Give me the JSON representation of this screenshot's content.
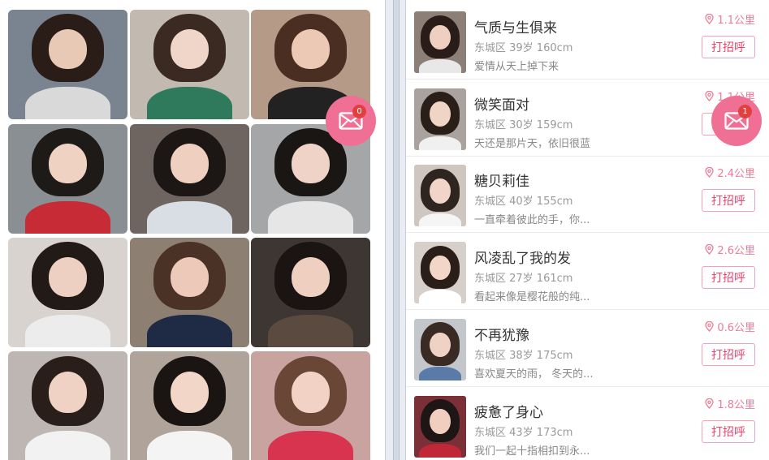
{
  "photo_grid": {
    "photos": [
      {
        "bg": "#7a8390",
        "hair": "#2a1d18",
        "skin": "#e8c9b6",
        "cloth": "#d9d9d9"
      },
      {
        "bg": "#c2b9b0",
        "hair": "#3a2a22",
        "skin": "#f0d6c8",
        "cloth": "#2f7a5c"
      },
      {
        "bg": "#b59a88",
        "hair": "#4a2e22",
        "skin": "#ecc9b4",
        "cloth": "#222222"
      },
      {
        "bg": "#8a8f94",
        "hair": "#1e1a18",
        "skin": "#f0d2c2",
        "cloth": "#c72b35"
      },
      {
        "bg": "#6e6460",
        "hair": "#1c1614",
        "skin": "#efcfc0",
        "cloth": "#d9dde4"
      },
      {
        "bg": "#a4a6a8",
        "hair": "#1a1614",
        "skin": "#eed3c6",
        "cloth": "#e6e6e6"
      },
      {
        "bg": "#d9d3cf",
        "hair": "#221a16",
        "skin": "#eed0c2",
        "cloth": "#ececec"
      },
      {
        "bg": "#8d8073",
        "hair": "#4a3226",
        "skin": "#ecc9b8",
        "cloth": "#1f2a45"
      },
      {
        "bg": "#3e3632",
        "hair": "#1a1412",
        "skin": "#efcfc0",
        "cloth": "#5a4a40"
      },
      {
        "bg": "#bdb6b2",
        "hair": "#2a1e1a",
        "skin": "#efd2c4",
        "cloth": "#f2f2f2"
      },
      {
        "bg": "#b0a49a",
        "hair": "#1a1412",
        "skin": "#f2d6c8",
        "cloth": "#f4f4f4"
      },
      {
        "bg": "#c9a3a0",
        "hair": "#6a4636",
        "skin": "#f3d2c6",
        "cloth": "#d8334f"
      }
    ]
  },
  "left_fab": {
    "badge": "0"
  },
  "right_fab": {
    "badge": "1"
  },
  "profiles": [
    {
      "name": "气质与生俱来",
      "meta": "东城区 39岁 160cm",
      "desc": "爱情从天上掉下来",
      "distance": "1.1公里",
      "button": "打招呼",
      "avatar": {
        "bg": "#8c7f77",
        "hair": "#2a1c18",
        "skin": "#efcfbf",
        "cloth": "#e8e8e8"
      }
    },
    {
      "name": "微笑面对",
      "meta": "东城区 30岁 159cm",
      "desc": "天还是那片天，依旧很蓝",
      "distance": "1.1公里",
      "button": "打招呼",
      "avatar": {
        "bg": "#a9a29e",
        "hair": "#2a1e18",
        "skin": "#f0d4c6",
        "cloth": "#f0f0f0"
      }
    },
    {
      "name": "糖贝莉佳",
      "meta": "东城区 40岁 155cm",
      "desc": "一直牵着彼此的手，你...",
      "distance": "2.4公里",
      "button": "打招呼",
      "avatar": {
        "bg": "#cfc6c0",
        "hair": "#2e2420",
        "skin": "#f1d5c8",
        "cloth": "#f5f5f5"
      }
    },
    {
      "name": "风凌乱了我的发",
      "meta": "东城区 27岁 161cm",
      "desc": "看起来像是樱花般的纯...",
      "distance": "2.6公里",
      "button": "打招呼",
      "avatar": {
        "bg": "#d7d0ca",
        "hair": "#2a1e18",
        "skin": "#f2d6c8",
        "cloth": "#ffffff"
      }
    },
    {
      "name": "不再犹豫",
      "meta": "东城区 38岁 175cm",
      "desc": "喜欢夏天的雨， 冬天的...",
      "distance": "0.6公里",
      "button": "打招呼",
      "avatar": {
        "bg": "#c3c7cc",
        "hair": "#3a2a24",
        "skin": "#f0d2c4",
        "cloth": "#5a7ba8"
      }
    },
    {
      "name": "疲惫了身心",
      "meta": "东城区 43岁 173cm",
      "desc": "我们一起十指相扣到永...",
      "distance": "1.8公里",
      "button": "打招呼",
      "avatar": {
        "bg": "#7b2f36",
        "hair": "#1e1614",
        "skin": "#f0cfc0",
        "cloth": "#c02838"
      }
    }
  ]
}
